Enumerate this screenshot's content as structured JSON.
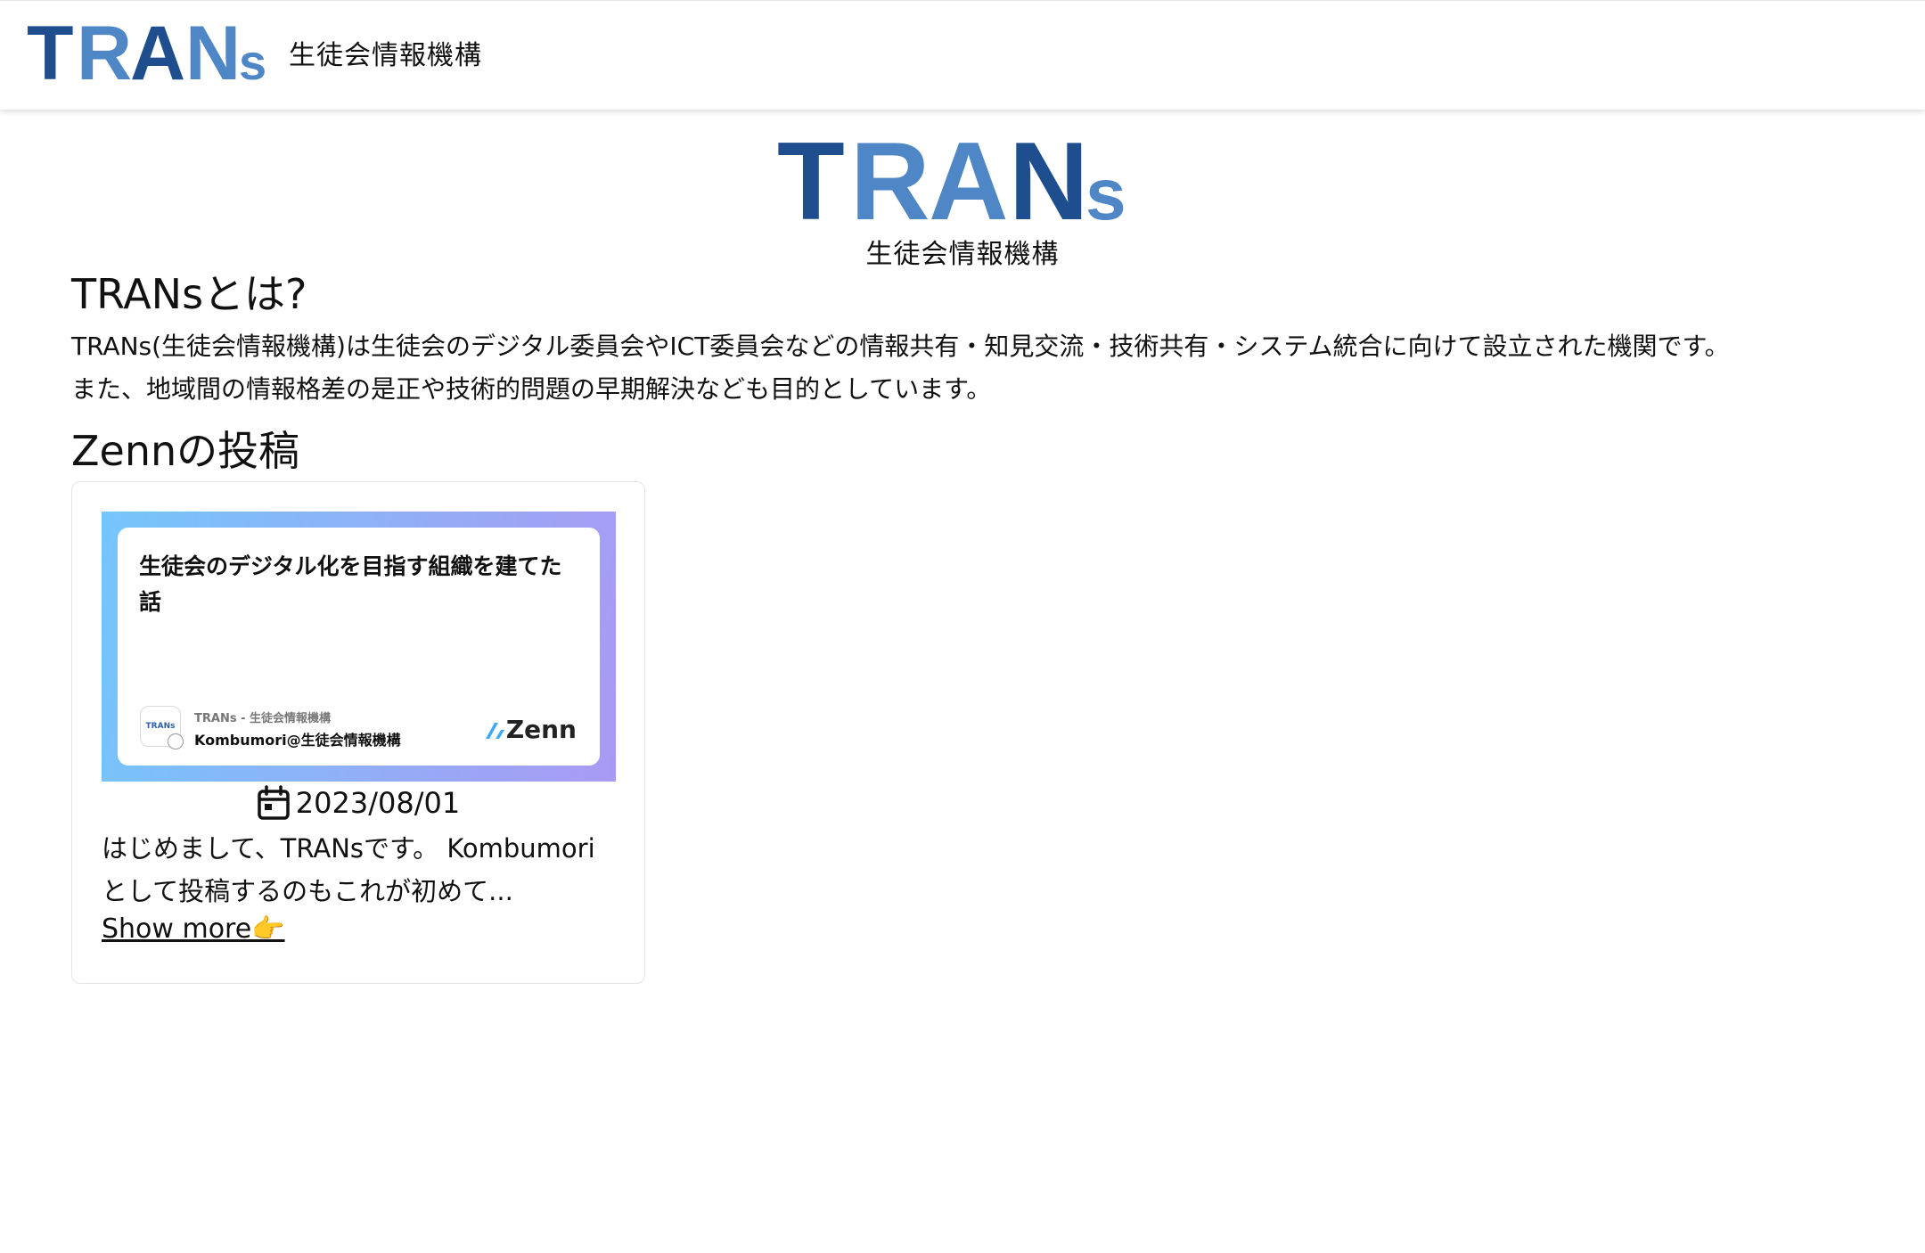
{
  "header": {
    "logo_text": "TRANs",
    "subtitle": "生徒会情報機構"
  },
  "hero": {
    "logo_text": "TRANs",
    "subtitle": "生徒会情報機構"
  },
  "about": {
    "title": "TRANsとは?",
    "paragraphs": [
      "TRANs(生徒会情報機構)は生徒会のデジタル委員会やICT委員会などの情報共有・知見交流・技術共有・システム統合に向けて設立された機関です。",
      "また、地域間の情報格差の是正や技術的問題の早期解決なども目的としています。"
    ]
  },
  "zenn": {
    "title": "Zennの投稿",
    "posts": [
      {
        "thumb_title": "生徒会のデジタル化を目指す組織を建てた話",
        "thumb_avatar_text": "TRANs",
        "thumb_org": "TRANs - 生徒会情報機構",
        "thumb_author": "Kombumori@生徒会情報機構",
        "thumb_brand": "Zenn",
        "date": "2023/08/01",
        "excerpt": "はじめまして、TRANsです。 Kombumoriとして投稿するのもこれが初めて...",
        "show_more": "Show more👉"
      }
    ]
  },
  "colors": {
    "logo_dark": "#1f4e8f",
    "logo_light": "#4f86c6",
    "thumb_gradient_start": "#74c6fb",
    "thumb_gradient_end": "#a99af3"
  },
  "icons": {
    "date": "calendar-icon",
    "zenn": "zenn-logo-icon"
  }
}
